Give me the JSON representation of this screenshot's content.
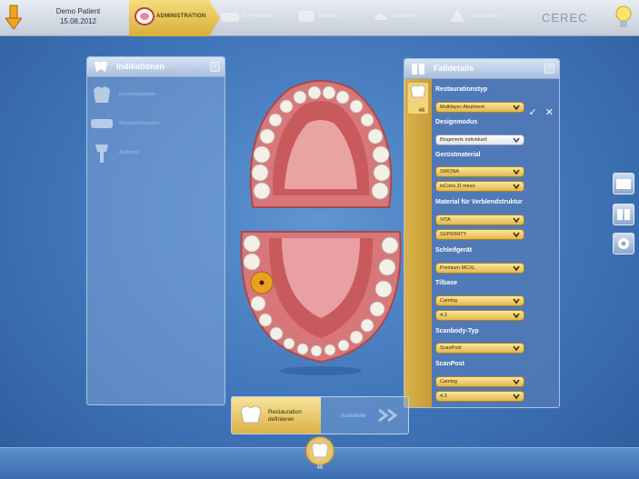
{
  "header": {
    "patient_name": "Demo Patient",
    "patient_date": "15.08.2012",
    "phases": [
      {
        "label": "ADMINISTRATION",
        "state": "active"
      },
      {
        "label": "AUFNAHME",
        "state": "inactive"
      },
      {
        "label": "MODELL",
        "state": "inactive"
      },
      {
        "label": "DESIGN",
        "state": "inactive"
      },
      {
        "label": "SCHLEIFEN",
        "state": "inactive"
      }
    ],
    "brand": "CEREC",
    "icons": [
      "back-arrow-icon",
      "lightbulb-icon"
    ]
  },
  "indikationen": {
    "title": "Indikationen",
    "minimize": "‹",
    "items": [
      {
        "label": "Einzelrestauration"
      },
      {
        "label": "Brückenrestauration"
      },
      {
        "label": "Abutment"
      }
    ]
  },
  "falldetails": {
    "title": "Falldetails",
    "minimize": "‹",
    "tooth_number": "46",
    "confirm": "✓",
    "cancel": "✕",
    "fields": [
      {
        "label": "Restaurationstyp",
        "values": [
          "Multilayer-Abutment"
        ],
        "style": "gold"
      },
      {
        "label": "Designmodus",
        "values": [
          "Biogenerik individuell"
        ],
        "style": "white"
      },
      {
        "label": "Gerüstmaterial",
        "values": [
          "SIRONA",
          "inCoris ZI meso"
        ],
        "style": "gold"
      },
      {
        "label": "Material für Verblendstruktur",
        "values": [
          "VITA",
          "SUPRINITY"
        ],
        "style": "gold"
      },
      {
        "label": "Schleifgerät",
        "values": [
          "Premium MCXL"
        ],
        "style": "gold"
      },
      {
        "label": "Tilbase",
        "values": [
          "Camlog",
          "4.3"
        ],
        "style": "gold"
      },
      {
        "label": "Scanbody-Typ",
        "values": [
          "ScanPost"
        ],
        "style": "gold"
      },
      {
        "label": "ScanPost",
        "values": [
          "Camlog",
          "4.3"
        ],
        "style": "gold"
      }
    ]
  },
  "steps": {
    "active_label": "Restauration definieren",
    "next_label": "Aufnahme"
  },
  "bottom": {
    "tooth_number": "46"
  },
  "colors": {
    "accent_gold": "#d9ae3a",
    "background_blue": "#4477bb",
    "selected_tooth": "#e8a21e"
  }
}
